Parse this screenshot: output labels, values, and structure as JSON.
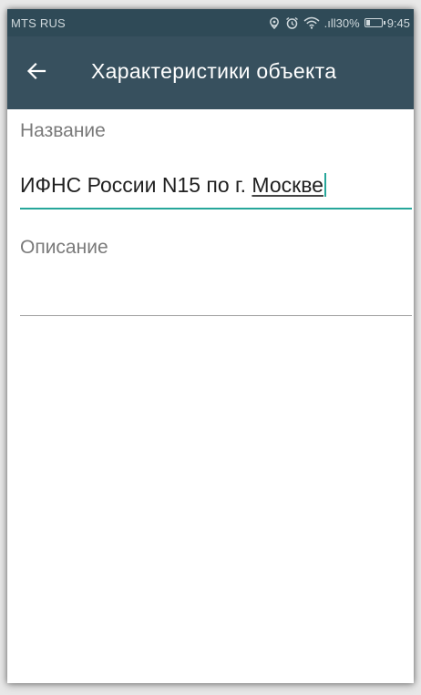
{
  "status_bar": {
    "carrier": "MTS RUS",
    "signal_percent": ".ıll30%",
    "battery_level": 0.3,
    "time": "9:45",
    "icons": [
      "location-icon",
      "alarm-icon",
      "wifi-icon",
      "signal-icon",
      "battery-icon"
    ]
  },
  "app_bar": {
    "title": "Характеристики объекта",
    "back_icon": "arrow-back-icon"
  },
  "form": {
    "name_label": "Название",
    "name_value_main": "ИФНС России N15 по г. ",
    "name_value_misspelled": "Москве",
    "description_label": "Описание",
    "description_value": ""
  },
  "colors": {
    "status_bar": "#2f4a57",
    "app_bar": "#37505e",
    "accent": "#26a69a",
    "underline_inactive": "#9e9e9e"
  }
}
